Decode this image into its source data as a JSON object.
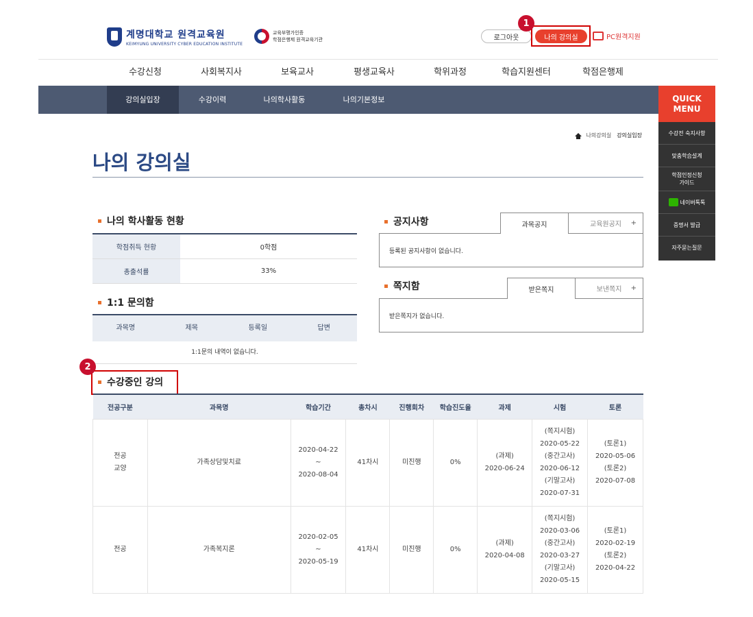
{
  "header": {
    "logo_main": "계명대학교 원격교육원",
    "logo_sub": "KEIMYUNG UNIVERSITY CYBER EDUCATION INSTITUTE",
    "cert_line1": "교육부평가인증",
    "cert_line2": "학점은행제 원격교육기관",
    "logout": "로그아웃",
    "my_class": "나의 강의실",
    "pc_support": "PC원격지원"
  },
  "badges": [
    "1",
    "2"
  ],
  "main_nav": [
    "수강신청",
    "사회복지사",
    "보육교사",
    "평생교육사",
    "학위과정",
    "학습지원센터",
    "학점은행제"
  ],
  "sub_nav": [
    "강의실입장",
    "수강이력",
    "나의학사활동",
    "나의기본정보"
  ],
  "quick": {
    "title1": "QUICK",
    "title2": "MENU",
    "items": [
      "수강전 숙지사항",
      "맞춤학습설계",
      "학점인정신청",
      "가이드",
      "네이버톡톡",
      "증명서 발급",
      "자주묻는질문"
    ]
  },
  "breadcrumb": {
    "parent": "나의강의실",
    "current": "강의실입장"
  },
  "page_title": "나의 강의실",
  "academic": {
    "title": "나의 학사활동 현황",
    "rows": [
      {
        "key": "학점취득 현황",
        "value": "0학점"
      },
      {
        "key": "총출석률",
        "value": "33%"
      }
    ]
  },
  "inquiry": {
    "title": "1:1 문의함",
    "headers": [
      "과목명",
      "제목",
      "등록일",
      "답변"
    ],
    "empty": "1:1문의 내역이 없습니다."
  },
  "notice": {
    "title": "공지사항",
    "tab_active": "과목공지",
    "tab_other": "교육원공지",
    "plus": "+",
    "empty": "등록된 공지사항이 없습니다."
  },
  "message": {
    "title": "쪽지함",
    "tab_active": "받은쪽지",
    "tab_other": "보낸쪽지",
    "plus": "+",
    "empty": "받은쪽지가 없습니다."
  },
  "courses": {
    "title": "수강중인 강의",
    "headers": [
      "전공구분",
      "과목명",
      "학습기간",
      "총차시",
      "진행회차",
      "학습진도율",
      "과제",
      "시험",
      "토론"
    ],
    "rows": [
      {
        "type1": "전공",
        "type2": "교양",
        "name": "가족상담및치료",
        "start": "2020-04-22",
        "tilde": "~",
        "end": "2020-08-04",
        "total": "41차시",
        "progress": "미진행",
        "rate": "0%",
        "task_label": "(과제)",
        "task_date": "2020-06-24",
        "exam": [
          "(쪽지시험)",
          "2020-05-22",
          "(중간고사)",
          "2020-06-12",
          "(기말고사)",
          "2020-07-31"
        ],
        "discuss": [
          "(토론1)",
          "2020-05-06",
          "(토론2)",
          "2020-07-08"
        ]
      },
      {
        "type1": "전공",
        "type2": "",
        "name": "가족복지론",
        "start": "2020-02-05",
        "tilde": "~",
        "end": "2020-05-19",
        "total": "41차시",
        "progress": "미진행",
        "rate": "0%",
        "task_label": "(과제)",
        "task_date": "2020-04-08",
        "exam": [
          "(쪽지시험)",
          "2020-03-06",
          "(중간고사)",
          "2020-03-27",
          "(기말고사)",
          "2020-05-15"
        ],
        "discuss": [
          "(토론1)",
          "2020-02-19",
          "(토론2)",
          "2020-04-22"
        ]
      }
    ]
  }
}
